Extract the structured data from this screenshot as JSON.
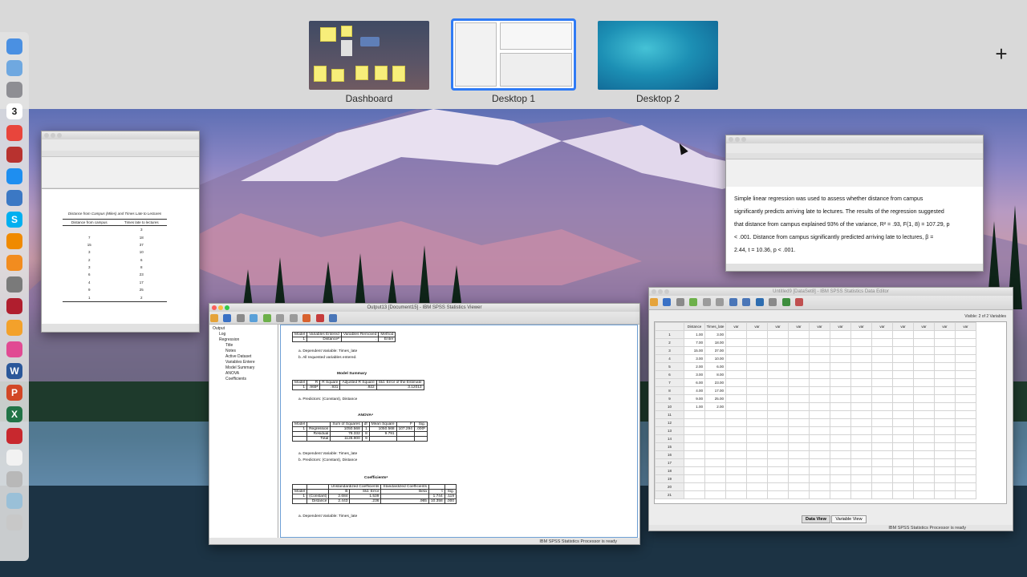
{
  "spaces": [
    {
      "label": "Dashboard"
    },
    {
      "label": "Desktop 1",
      "selected": true
    },
    {
      "label": "Desktop 2"
    }
  ],
  "add_space_label": "+",
  "colors": {
    "selection": "#2f7bf5",
    "spaces_bar": "#d9d9d9"
  },
  "dock": {
    "icons": [
      "finder-icon",
      "mail-icon",
      "rocket-icon",
      "calendar-icon",
      "chrome-icon",
      "photo-booth-icon",
      "app-store-icon",
      "xquartz-icon",
      "skype-icon",
      "vlc-icon",
      "orange-app-icon",
      "system-preferences-icon",
      "mendeley-icon",
      "photos-icon",
      "itunes-icon",
      "word-icon",
      "powerpoint-icon",
      "excel-icon",
      "spss-icon",
      "document-icon",
      "preview-icon",
      "screenshot-icon",
      "trash-icon"
    ],
    "calendar_day": "3"
  },
  "word_left": {
    "table_caption": "Distance from Campus (Miles) and Times Late to Lectures",
    "col_headers": [
      "Distance from campus",
      "Times late to lectures"
    ],
    "rows": [
      [
        "",
        "3"
      ],
      [
        "7",
        "18"
      ],
      [
        "15",
        "37"
      ],
      [
        "3",
        "10"
      ],
      [
        "2",
        "6"
      ],
      [
        "3",
        "8"
      ],
      [
        "6",
        "23"
      ],
      [
        "4",
        "17"
      ],
      [
        "9",
        "25"
      ],
      [
        "1",
        "2"
      ]
    ]
  },
  "word_right": {
    "paragraph_lines": [
      "Simple linear regression was used to assess whether distance from campus",
      "significantly predicts arriving late to lectures. The results of the regression suggested",
      "that distance from campus explained 93% of the variance, R² = .93, F(1, 8) = 107.29, p",
      "< .001. Distance from campus significantly predicted arriving late to lectures, β =",
      "2.44, t = 10.36, p < .001."
    ]
  },
  "spss_viewer": {
    "title": "Output13 [Document15] - IBM SPSS Statistics Viewer",
    "nav_items": [
      "Output",
      "Log",
      "Regression",
      "Title",
      "Notes",
      "Active Dataset",
      "Variables Entere",
      "Model Summary",
      "ANOVA",
      "Coefficients"
    ],
    "status": "IBM SPSS Statistics Processor is ready",
    "variables_table": {
      "headers": [
        "Model",
        "Variables Entered",
        "Variables Removed",
        "Method"
      ],
      "row": [
        "1",
        "Distanceᵇ",
        ".",
        "Enter"
      ],
      "notes": [
        "a. Dependent Variable: Times_late",
        "b. All requested variables entered."
      ]
    },
    "model_summary": {
      "title": "Model Summary",
      "headers": [
        "Model",
        "R",
        "R Square",
        "Adjusted R Square",
        "Std. Error of the Estimate"
      ],
      "row": [
        "1",
        ".965ᵃ",
        ".931",
        ".922",
        "3.12013"
      ],
      "note": "a. Predictors: (Constant), Distance"
    },
    "anova": {
      "title": "ANOVAᵃ",
      "headers": [
        "Model",
        "",
        "Sum of Squares",
        "df",
        "Mean Square",
        "F",
        "Sig."
      ],
      "rows": [
        [
          "1",
          "Regression",
          "1050.568",
          "1",
          "1050.568",
          "107.294",
          ".000ᵇ"
        ],
        [
          "",
          "Residual",
          "78.332",
          "8",
          "9.791",
          "",
          ""
        ],
        [
          "",
          "Total",
          "1128.900",
          "9",
          "",
          "",
          ""
        ]
      ],
      "notes": [
        "a. Dependent Variable: Times_late",
        "b. Predictors: (Constant), Distance"
      ]
    },
    "coefficients": {
      "title": "Coefficientsᵃ",
      "group_headers": [
        "Unstandardized Coefficients",
        "Standardized Coefficients"
      ],
      "headers": [
        "Model",
        "",
        "B",
        "Std. Error",
        "Beta",
        "t",
        "Sig."
      ],
      "rows": [
        [
          "1",
          "(Constant)",
          "2.684",
          "1.539",
          "",
          "1.744",
          ".119"
        ],
        [
          "",
          "Distance",
          "2.443",
          ".236",
          ".965",
          "10.358",
          ".000"
        ]
      ],
      "note": "a. Dependent Variable: Times_late"
    }
  },
  "spss_data": {
    "title": "Untitled9 [DataSet8] - IBM SPSS Statistics Data Editor",
    "visible_label": "Visible: 2 of 2 Variables",
    "columns": [
      "Distance",
      "Times_late",
      "var",
      "var",
      "var",
      "var",
      "var",
      "var",
      "var",
      "var",
      "var",
      "var",
      "var",
      "var"
    ],
    "rows": [
      [
        "1.00",
        "3.00"
      ],
      [
        "7.00",
        "18.00"
      ],
      [
        "15.00",
        "37.00"
      ],
      [
        "3.00",
        "10.00"
      ],
      [
        "2.00",
        "6.00"
      ],
      [
        "3.00",
        "8.00"
      ],
      [
        "6.00",
        "23.00"
      ],
      [
        "4.00",
        "17.00"
      ],
      [
        "9.00",
        "25.00"
      ],
      [
        "1.00",
        "2.00"
      ]
    ],
    "tabs": [
      "Data View",
      "Variable View"
    ],
    "status": "IBM SPSS Statistics Processor is ready"
  }
}
